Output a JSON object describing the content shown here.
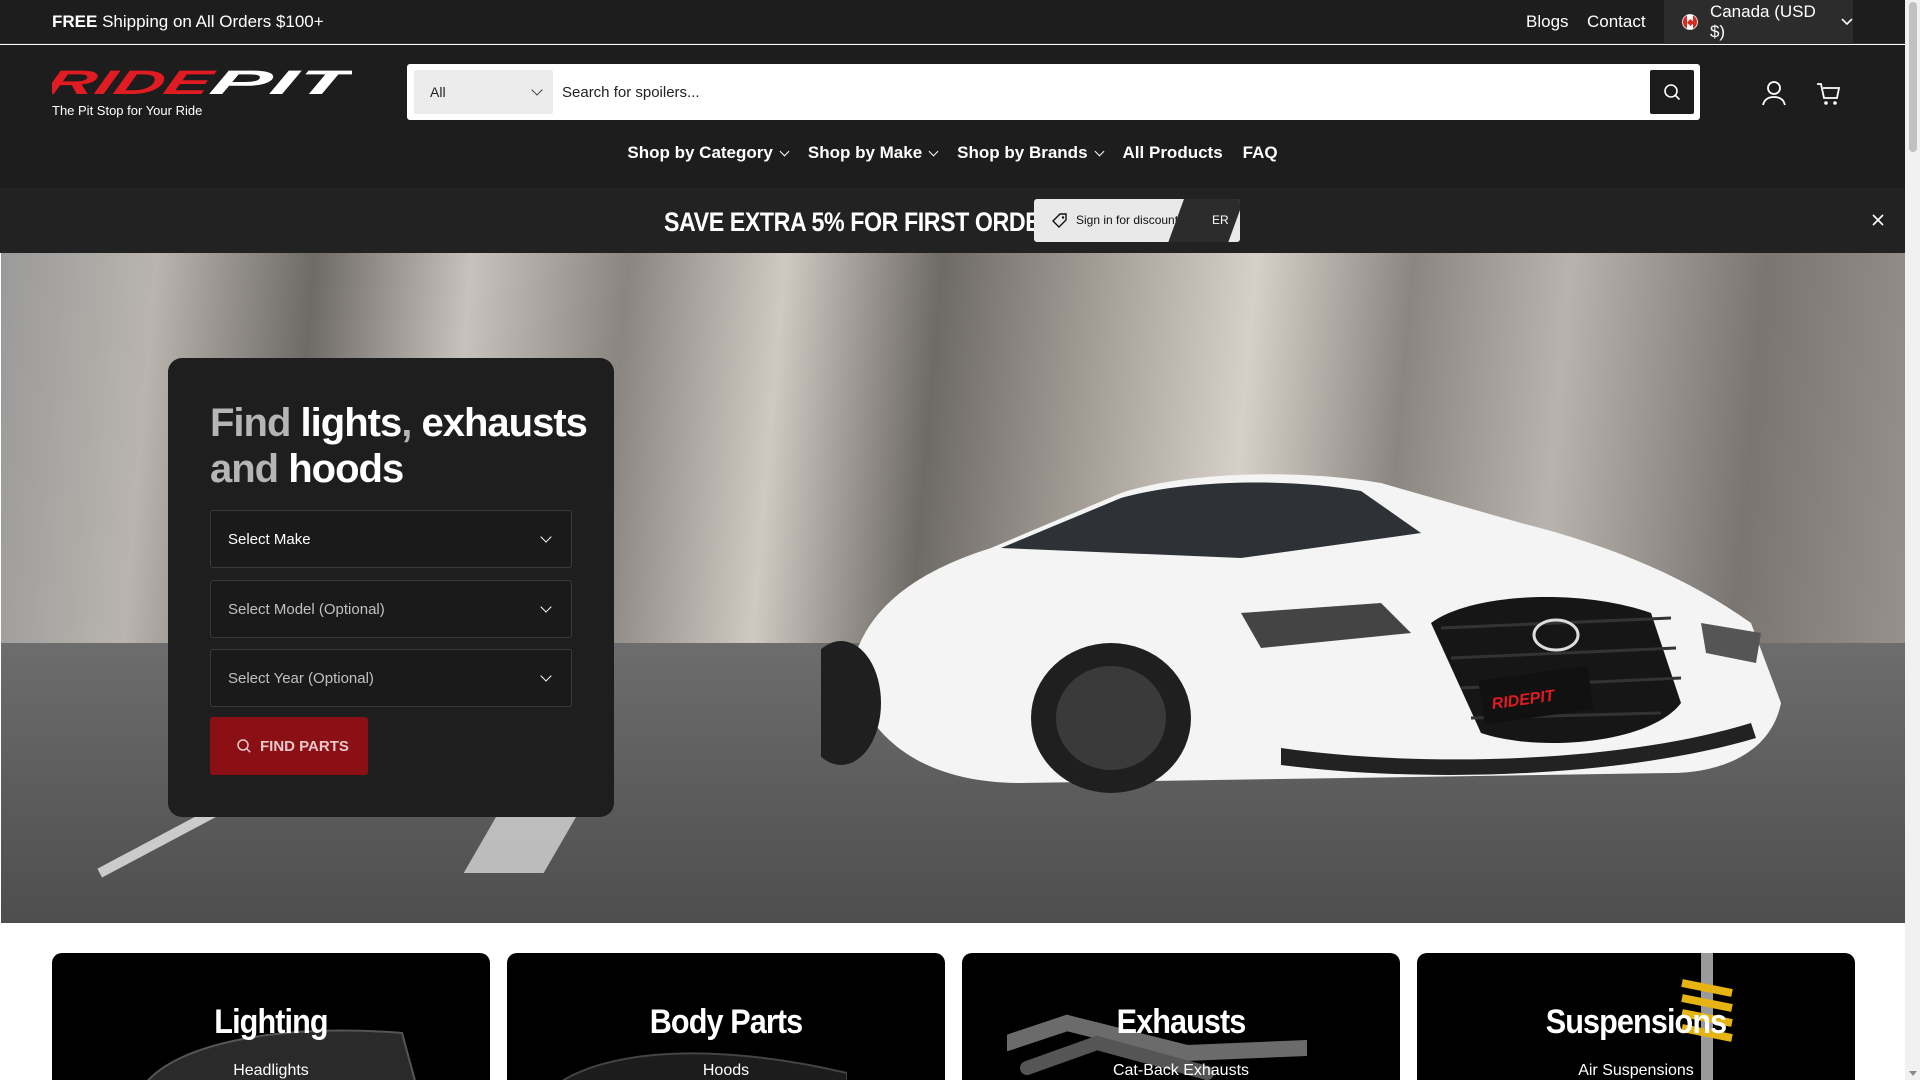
{
  "topbar": {
    "shipping_bold": "FREE",
    "shipping_rest": " Shipping on All Orders $100+",
    "links": [
      "Blogs",
      "Contact"
    ],
    "country": "Canada (USD $)"
  },
  "header": {
    "logo_text": "RIDEPIT",
    "tagline": "The Pit Stop for Your Ride",
    "search": {
      "category": "All",
      "placeholder": "Search for spoilers..."
    },
    "nav": [
      {
        "label": "Shop by Category",
        "dropdown": true
      },
      {
        "label": "Shop by Make",
        "dropdown": true
      },
      {
        "label": "Shop by Brands",
        "dropdown": true
      },
      {
        "label": "All Products",
        "dropdown": false
      },
      {
        "label": "FAQ",
        "dropdown": false
      }
    ]
  },
  "promo": {
    "text": "SAVE EXTRA 5% FOR FIRST ORDER",
    "button": "Sign in for discount",
    "button_tail": "ER"
  },
  "finder": {
    "title_1": "Find",
    "title_2": "lights",
    "title_3": ",",
    "title_4": "exhausts",
    "title_5": "and",
    "title_6": "hoods",
    "make": "Select Make",
    "model": "Select Model (Optional)",
    "year": "Select Year (Optional)",
    "button": "FIND PARTS"
  },
  "plate_text": "RIDEPIT",
  "categories": [
    {
      "title": "Lighting",
      "sub": "Headlights"
    },
    {
      "title": "Body Parts",
      "sub": "Hoods"
    },
    {
      "title": "Exhausts",
      "sub": "Cat-Back Exhausts"
    },
    {
      "title": "Suspensions",
      "sub": "Air Suspensions"
    }
  ],
  "colors": {
    "header_bg": "#1d1d1d",
    "accent_red": "#e01b22",
    "find_button": "#8b1016"
  }
}
